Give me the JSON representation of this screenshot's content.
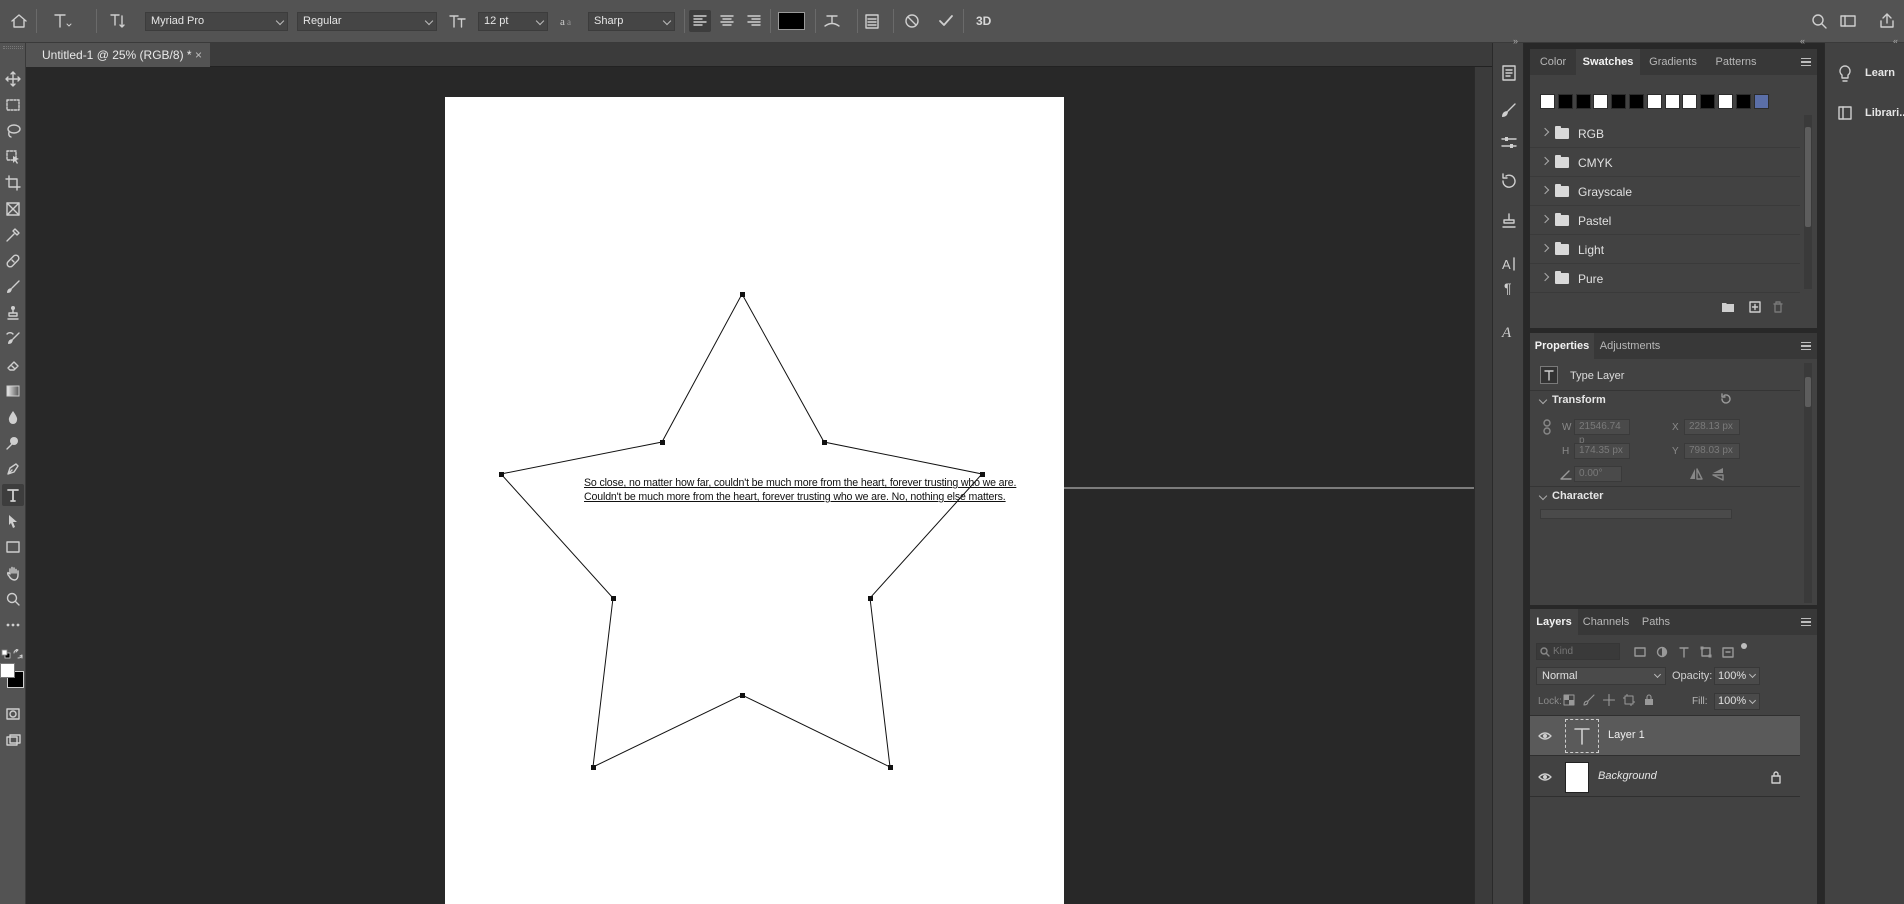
{
  "options_bar": {
    "font_family": "Myriad Pro",
    "font_style": "Regular",
    "font_size": "12 pt",
    "anti_alias": "Sharp",
    "text_color": "#000000",
    "three_d_label": "3D"
  },
  "document": {
    "tab_title": "Untitled-1 @ 25% (RGB/8) *",
    "close_glyph": "×",
    "text_line_1": "So close, no matter how far, couldn't be much more from the heart, forever trusting who we are.",
    "text_line_2": "Couldn't be much more from the heart, forever trusting who we are. No, nothing else matters."
  },
  "swatches_panel": {
    "tabs": [
      "Color",
      "Swatches",
      "Gradients",
      "Patterns"
    ],
    "active_tab": "Swatches",
    "swatch_colors": [
      "#ffffff",
      "#000000",
      "#000000",
      "#ffffff",
      "#000000",
      "#000000",
      "#ffffff",
      "#ffffff",
      "#ffffff",
      "#000000",
      "#ffffff",
      "#000000",
      "#5b6fa8"
    ],
    "groups": [
      "RGB",
      "CMYK",
      "Grayscale",
      "Pastel",
      "Light",
      "Pure"
    ]
  },
  "properties_panel": {
    "tabs": [
      "Properties",
      "Adjustments"
    ],
    "active_tab": "Properties",
    "layer_type": "Type Layer",
    "transform_label": "Transform",
    "w_label": "W",
    "w_value": "21546.74 p",
    "x_label": "X",
    "x_value": "228.13 px",
    "h_label": "H",
    "h_value": "174.35 px",
    "y_label": "Y",
    "y_value": "798.03 px",
    "angle_value": "0.00°",
    "character_label": "Character"
  },
  "layers_panel": {
    "tabs": [
      "Layers",
      "Channels",
      "Paths"
    ],
    "active_tab": "Layers",
    "kind_placeholder": "Kind",
    "blend_mode": "Normal",
    "opacity_label": "Opacity:",
    "opacity_value": "100%",
    "lock_label": "Lock:",
    "fill_label": "Fill:",
    "fill_value": "100%",
    "layers": [
      {
        "name": "Layer 1",
        "type": "text"
      },
      {
        "name": "Background",
        "type": "pixel"
      }
    ]
  },
  "right_strip": {
    "items": [
      "Learn",
      "Librari..."
    ]
  }
}
